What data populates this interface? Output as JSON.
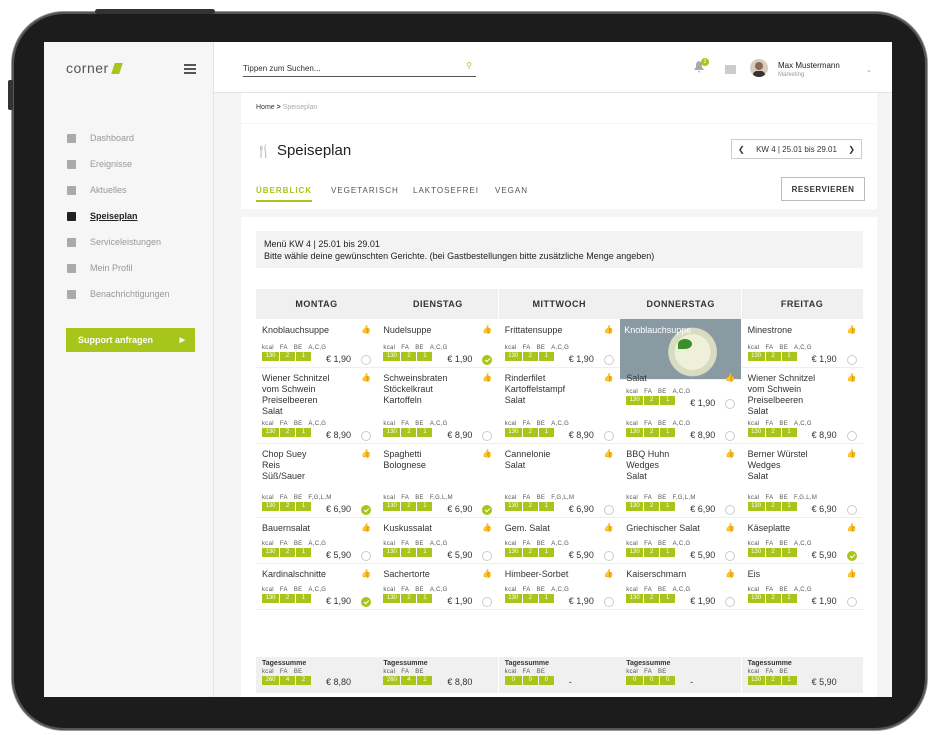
{
  "app": {
    "logo": "corner"
  },
  "search": {
    "placeholder": "Tippen zum Suchen..."
  },
  "notifications": {
    "badge": "2"
  },
  "user": {
    "name": "Max Mustermann",
    "role": "Marketing"
  },
  "sidebar": {
    "items": [
      {
        "label": "Dashboard",
        "active": false
      },
      {
        "label": "Ereignisse",
        "active": false
      },
      {
        "label": "Aktuelles",
        "active": false
      },
      {
        "label": "Speiseplan",
        "active": true
      },
      {
        "label": "Serviceleistungen",
        "active": false
      },
      {
        "label": "Mein Profil",
        "active": false
      },
      {
        "label": "Benachrichtigungen",
        "active": false
      }
    ],
    "support_label": "Support anfragen"
  },
  "breadcrumb": {
    "home": "Home",
    "current": "Speiseplan"
  },
  "page": {
    "title": "Speiseplan",
    "week": "KW 4 | 25.01 bis 29.01"
  },
  "tabs": [
    "ÜBERBLICK",
    "VEGETARISCH",
    "LAKTOSEFREI",
    "VEGAN"
  ],
  "reserve_label": "RESERVIEREN",
  "info": {
    "line1": "Menü KW 4 | 25.01 bis 29.01",
    "line2": "Bitte wähle deine gewünschten Gerichte. (bei Gastbestellungen bitte zusätzliche Menge angeben)"
  },
  "nutrition_labels": [
    "kcal",
    "FA",
    "BE"
  ],
  "days": [
    {
      "name": "MONTAG",
      "dishes": [
        {
          "name": "Knoblauchsuppe",
          "allergens": "A,C,G",
          "vals": [
            "130",
            "2",
            "1"
          ],
          "price": "€ 1,90",
          "liked": false,
          "selected": false
        },
        {
          "name": "Wiener Schnitzel\nvom Schwein\nPreiselbeeren\nSalat",
          "allergens": "A,C,G",
          "vals": [
            "130",
            "2",
            "1"
          ],
          "price": "€ 8,90",
          "liked": false,
          "selected": false
        },
        {
          "name": "Chop Suey\nReis\nSüß/Sauer",
          "allergens": "F,G,L,M",
          "vals": [
            "130",
            "2",
            "1"
          ],
          "price": "€ 6,90",
          "liked": true,
          "selected": true
        },
        {
          "name": "Bauernsalat",
          "allergens": "A,C,G",
          "vals": [
            "130",
            "2",
            "1"
          ],
          "price": "€ 5,90",
          "liked": false,
          "selected": false
        },
        {
          "name": "Kardinalschnitte",
          "allergens": "A,C,G",
          "vals": [
            "130",
            "2",
            "1"
          ],
          "price": "€ 1,90",
          "liked": false,
          "selected": true
        }
      ],
      "sum": {
        "title": "Tagessumme",
        "vals": [
          "260",
          "4",
          "2"
        ],
        "price": "€ 8,80"
      }
    },
    {
      "name": "DIENSTAG",
      "dishes": [
        {
          "name": "Nudelsuppe",
          "allergens": "A,C,G",
          "vals": [
            "130",
            "2",
            "1"
          ],
          "price": "€ 1,90",
          "liked": true,
          "selected": true
        },
        {
          "name": "Schweinsbraten\nStöckelkraut\nKartoffeln",
          "allergens": "A,C,G",
          "vals": [
            "130",
            "2",
            "1"
          ],
          "price": "€ 8,90",
          "liked": false,
          "selected": false
        },
        {
          "name": "Spaghetti\nBolognese",
          "allergens": "F,G,L,M",
          "vals": [
            "130",
            "2",
            "1"
          ],
          "price": "€ 6,90",
          "liked": false,
          "selected": true
        },
        {
          "name": "Kuskussalat",
          "allergens": "A,C,G",
          "vals": [
            "130",
            "2",
            "1"
          ],
          "price": "€ 5,90",
          "liked": false,
          "selected": false
        },
        {
          "name": "Sachertorte",
          "allergens": "A,C,G",
          "vals": [
            "130",
            "2",
            "1"
          ],
          "price": "€ 1,90",
          "liked": false,
          "selected": false
        }
      ],
      "sum": {
        "title": "Tagessumme",
        "vals": [
          "260",
          "4",
          "2"
        ],
        "price": "€ 8,80"
      }
    },
    {
      "name": "MITTWOCH",
      "dishes": [
        {
          "name": "Frittatensuppe",
          "allergens": "A,C,G",
          "vals": [
            "130",
            "2",
            "1"
          ],
          "price": "€ 1,90",
          "liked": false,
          "selected": false
        },
        {
          "name": "Rinderfilet\nKartoffelstampf\nSalat",
          "allergens": "A,C,G",
          "vals": [
            "130",
            "2",
            "1"
          ],
          "price": "€ 8,90",
          "liked": false,
          "selected": false
        },
        {
          "name": "Cannelonie\nSalat",
          "allergens": "F,G,L,M",
          "vals": [
            "130",
            "2",
            "1"
          ],
          "price": "€ 6,90",
          "liked": true,
          "selected": false
        },
        {
          "name": "Gem. Salat",
          "allergens": "A,C,G",
          "vals": [
            "130",
            "2",
            "1"
          ],
          "price": "€ 5,90",
          "liked": false,
          "selected": false
        },
        {
          "name": "Himbeer-Sorbet",
          "allergens": "A,C,G",
          "vals": [
            "130",
            "2",
            "1"
          ],
          "price": "€ 1,90",
          "liked": false,
          "selected": false
        }
      ],
      "sum": {
        "title": "Tagessumme",
        "vals": [
          "0",
          "0",
          "0"
        ],
        "price": "-"
      }
    },
    {
      "name": "DONNERSTAG",
      "dishes": [
        {
          "name": "Knoblauchsuppe",
          "allergens": "A,C,G",
          "vals": [
            "130",
            "2",
            "1"
          ],
          "price": "€ 1,90",
          "liked": false,
          "selected": false
        },
        {
          "name": "Salat",
          "allergens": "A,C,G",
          "vals": [
            "130",
            "2",
            "1"
          ],
          "price": "€ 8,90",
          "liked": false,
          "selected": false
        },
        {
          "name": "BBQ Huhn\nWedges\nSalat",
          "allergens": "F,G,L,M",
          "vals": [
            "130",
            "2",
            "1"
          ],
          "price": "€ 6,90",
          "liked": false,
          "selected": false
        },
        {
          "name": "Griechischer Salat",
          "allergens": "A,C,G",
          "vals": [
            "130",
            "2",
            "1"
          ],
          "price": "€ 5,90",
          "liked": false,
          "selected": false
        },
        {
          "name": "Kaiserschmarn",
          "allergens": "A,C,G",
          "vals": [
            "130",
            "2",
            "1"
          ],
          "price": "€ 1,90",
          "liked": false,
          "selected": false
        }
      ],
      "sum": {
        "title": "Tagessumme",
        "vals": [
          "0",
          "0",
          "0"
        ],
        "price": "-"
      }
    },
    {
      "name": "FREITAG",
      "dishes": [
        {
          "name": "Minestrone",
          "allergens": "A,C,G",
          "vals": [
            "130",
            "2",
            "1"
          ],
          "price": "€ 1,90",
          "liked": true,
          "selected": false
        },
        {
          "name": "Wiener Schnitzel\nvom Schwein\nPreiselbeeren\nSalat",
          "allergens": "A,C,G",
          "vals": [
            "130",
            "2",
            "1"
          ],
          "price": "€ 8,90",
          "liked": false,
          "selected": false
        },
        {
          "name": "Berner Würstel\nWedges\nSalat",
          "allergens": "F,G,L,M",
          "vals": [
            "130",
            "2",
            "1"
          ],
          "price": "€ 6,90",
          "liked": true,
          "selected": false
        },
        {
          "name": "Käseplatte",
          "allergens": "A,C,G",
          "vals": [
            "130",
            "2",
            "1"
          ],
          "price": "€ 5,90",
          "liked": false,
          "selected": true
        },
        {
          "name": "Eis",
          "allergens": "A,C,G",
          "vals": [
            "130",
            "2",
            "1"
          ],
          "price": "€ 1,90",
          "liked": false,
          "selected": false
        }
      ],
      "sum": {
        "title": "Tagessumme",
        "vals": [
          "130",
          "2",
          "1"
        ],
        "price": "€ 5,90"
      }
    }
  ]
}
